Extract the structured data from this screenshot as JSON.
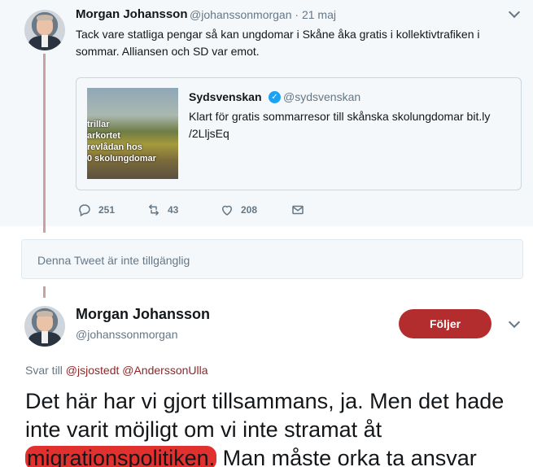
{
  "tweet1": {
    "name": "Morgan Johansson",
    "handle": "@johanssonmorgan",
    "time": "· 21 maj",
    "text": "Tack vare statliga pengar så kan ungdomar i Skåne åka gratis i kollektivtrafiken i sommar. Alliansen och SD var emot.",
    "quote": {
      "name": "Sydsvenskan",
      "handle": "@sydsvenskan",
      "text": "Klart för gratis sommarresor till skånska skolungdomar bit.ly /2LljsEq",
      "image_overlay_lines": [
        "trillar",
        "arkortet",
        "revlådan hos",
        "0 skolungdomar"
      ]
    },
    "actions": {
      "replies": "251",
      "retweets": "43",
      "likes": "208"
    }
  },
  "unavailable": {
    "text": "Denna Tweet är inte tillgänglig"
  },
  "tweet2": {
    "name": "Morgan Johansson",
    "handle": "@johanssonmorgan",
    "follow_label": "Följer",
    "reply_prefix": "Svar till",
    "reply_mentions": "@jsjostedt @AnderssonUlla",
    "text_part1": "Det här har vi gjort tillsammans, ja. Men det hade inte varit möjligt om vi inte stramat åt ",
    "text_highlight": "migrationspolitiken.",
    "text_part2": " Man måste orka ta ansvar"
  },
  "colors": {
    "brand_red": "#b32d2e",
    "verified_blue": "#1da1f2",
    "highlight_red": "#e0312f"
  }
}
